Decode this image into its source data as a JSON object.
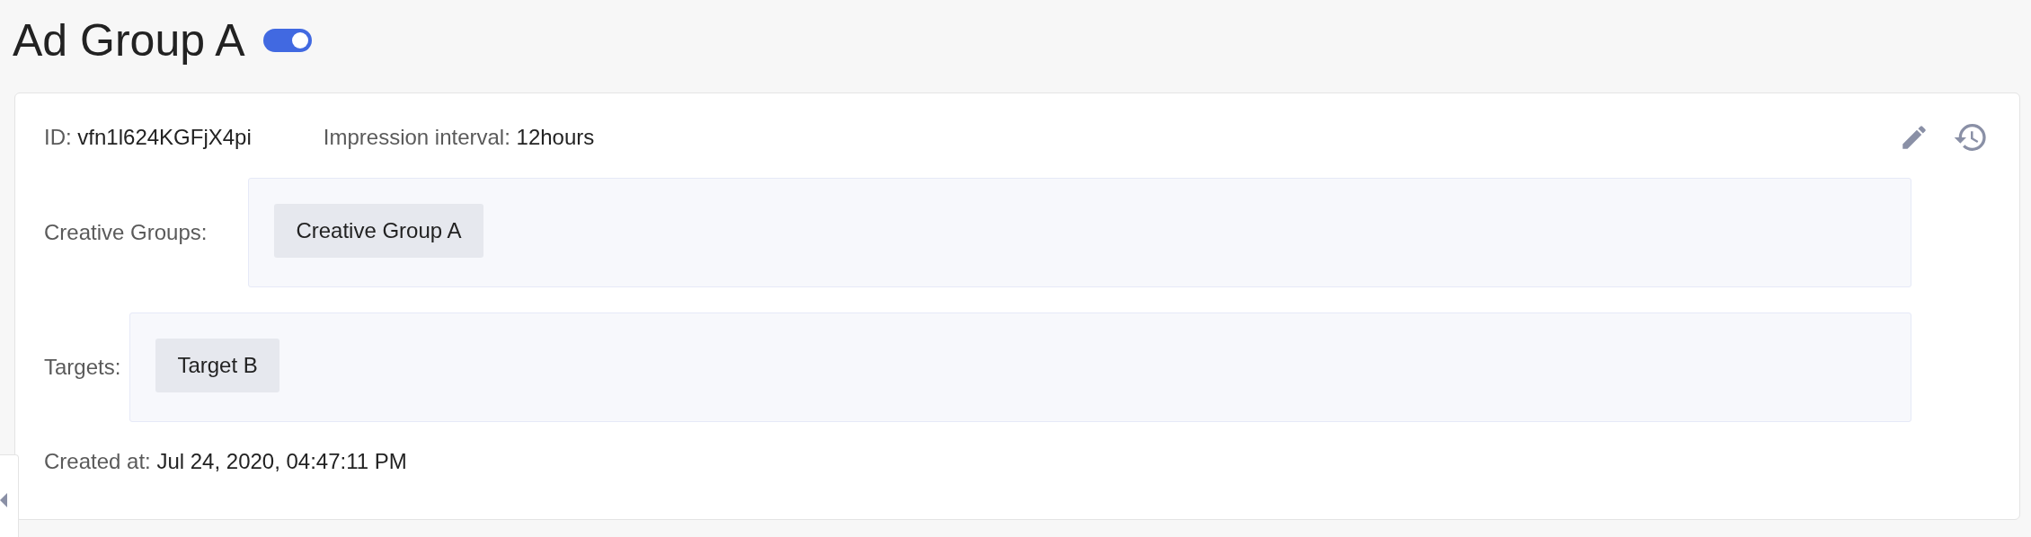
{
  "title": "Ad Group A",
  "enabled": true,
  "fields": [
    {
      "label": "ID:",
      "value": "vfn1l624KGFjX4pi"
    },
    {
      "label": "Impression interval:",
      "value": "12hours"
    }
  ],
  "creative_groups": {
    "label": "Creative Groups:",
    "items": [
      "Creative Group A"
    ]
  },
  "targets": {
    "label": "Targets:",
    "items": [
      "Target B"
    ]
  },
  "created_at": {
    "label": "Created at:",
    "value": "Jul 24, 2020, 04:47:11 PM"
  }
}
